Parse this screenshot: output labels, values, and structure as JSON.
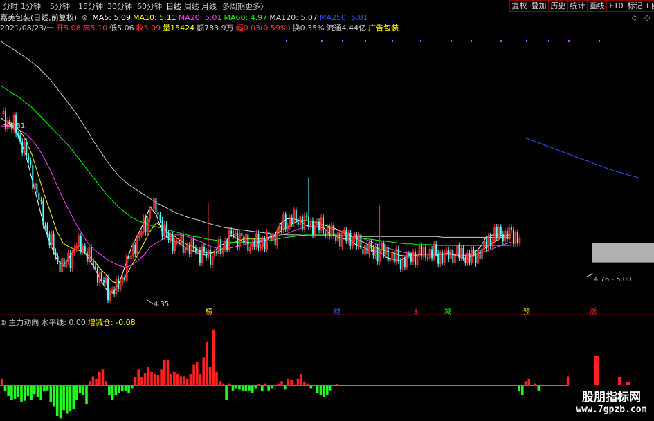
{
  "toolbar": {
    "timeframes": [
      "分时",
      "1分钟",
      "5分钟",
      "15分钟",
      "30分钟",
      "60分钟",
      "日线",
      "周线",
      "月线",
      "多周期",
      "更多〉"
    ],
    "active_timeframe": "日线",
    "right_buttons": [
      "复权",
      "叠加",
      "历史",
      "统计",
      "画线",
      "F10",
      "标记",
      "+自"
    ]
  },
  "header": {
    "stock_name": "嘉美包装(日线,前复权)",
    "ma": [
      {
        "label": "MA5: 5.09",
        "color": "#ffffff"
      },
      {
        "label": "MA10: 5.11",
        "color": "#ffff00"
      },
      {
        "label": "MA20: 5.01",
        "color": "#ff40ff"
      },
      {
        "label": "MA60: 4.97",
        "color": "#00ff00"
      },
      {
        "label": "MA120: 5.07",
        "color": "#d0d0d0"
      },
      {
        "label": "MA250: 5.81",
        "color": "#3050ff"
      }
    ]
  },
  "quote": {
    "date": "2021/08/23/一",
    "open_label": "开",
    "open": "5.08",
    "high_label": "高",
    "high": "5.10",
    "low_label": "低",
    "low": "5.06",
    "close_label": "收",
    "close": "5.09",
    "vol_label": "量",
    "vol": "15424",
    "amount_label": "额",
    "amount": "783.9万",
    "chg_label": "幅",
    "chg": "0.03(0.59%)",
    "turnover_label": "换",
    "turnover": "0.35%",
    "float_label": "流通",
    "float": "4.44亿",
    "sector": "广告包装"
  },
  "indicator": {
    "name": "主力动向",
    "level_label": "水平线: 0.00",
    "delta_label": "增减仓: -0.08"
  },
  "annotations": {
    "high_price": "6.81",
    "low_price": "4.35",
    "range": "4.76 - 5.00"
  },
  "event_markers": [
    {
      "text": "榜",
      "color": "#ffd700"
    },
    {
      "text": "财",
      "color": "#3060ff"
    },
    {
      "text": "$",
      "color": "#ff3030"
    },
    {
      "text": "减",
      "color": "#00ff00"
    },
    {
      "text": "预",
      "color": "#ffd700"
    },
    {
      "text": "涨",
      "color": "#ff3030"
    }
  ],
  "watermark": {
    "line1": "股朋指标网",
    "line2": "www.7gpzb.com"
  },
  "colors": {
    "up": "#ff3232",
    "down": "#54ffff",
    "hist_up": "#ff2020",
    "hist_down": "#20ff20"
  },
  "chart_data": [
    {
      "type": "line",
      "title": "",
      "xlabel": "",
      "ylabel": "",
      "ylim": [
        4.2,
        7.6
      ],
      "x": [
        0,
        3,
        6,
        9,
        12,
        15,
        18,
        21,
        24,
        27,
        30,
        33,
        36,
        39,
        42,
        45,
        48,
        51,
        54,
        57,
        60,
        63,
        66,
        69,
        72,
        75,
        78,
        81,
        84,
        87,
        90,
        93,
        96,
        99,
        102,
        105,
        108,
        111,
        114,
        117,
        120,
        123,
        126,
        129,
        132,
        135,
        138,
        141,
        144,
        147,
        150,
        153,
        156,
        159,
        162,
        165,
        168,
        171,
        174,
        177,
        180,
        183,
        186,
        189,
        192,
        195,
        198,
        201,
        204,
        207,
        210,
        213,
        216,
        219,
        222,
        225,
        228,
        231,
        234,
        237,
        240,
        243,
        246,
        249,
        252,
        255,
        258,
        261,
        264,
        267,
        270,
        273,
        276,
        279,
        282,
        285,
        288,
        291,
        294,
        297,
        300,
        303,
        306
      ],
      "series": [
        {
          "name": "MA5",
          "values": [
            6.55,
            6.5,
            6.45,
            6.3,
            6.1,
            5.8,
            5.5,
            5.2,
            4.98,
            4.8,
            4.72,
            4.82,
            4.95,
            4.95,
            4.82,
            4.7,
            4.55,
            4.42,
            4.38,
            4.5,
            4.72,
            4.95,
            5.1,
            5.25,
            5.45,
            5.35,
            5.12,
            5.05,
            5.02,
            4.98,
            4.92,
            4.9,
            4.86,
            4.85,
            4.88,
            4.95,
            5.0,
            5.1,
            5.05,
            5.02,
            5.0,
            5.0,
            5.02,
            5.05,
            5.1,
            5.25,
            5.3,
            5.3,
            5.28,
            5.22,
            5.2,
            5.2,
            5.18,
            5.1,
            5.08,
            5.05,
            5.05,
            4.98,
            4.95,
            4.92,
            4.9,
            4.88,
            4.82,
            4.8,
            4.78,
            4.82,
            4.86,
            4.86,
            4.86,
            4.86,
            4.85,
            4.86,
            4.88,
            4.85,
            4.82,
            4.8,
            4.88,
            4.95,
            5.08,
            5.1,
            5.1,
            5.09,
            5.09
          ]
        },
        {
          "name": "MA10",
          "values": [
            6.5,
            6.5,
            6.48,
            6.4,
            6.28,
            6.1,
            5.85,
            5.6,
            5.38,
            5.15,
            5.0,
            4.95,
            4.92,
            4.9,
            4.85,
            4.78,
            4.68,
            4.6,
            4.52,
            4.5,
            4.58,
            4.72,
            4.85,
            5.0,
            5.15,
            5.25,
            5.2,
            5.12,
            5.08,
            5.02,
            4.98,
            4.95,
            4.9,
            4.88,
            4.88,
            4.9,
            4.95,
            5.0,
            5.02,
            5.05,
            5.05,
            5.05,
            5.05,
            5.07,
            5.1,
            5.15,
            5.2,
            5.25,
            5.28,
            5.28,
            5.27,
            5.25,
            5.22,
            5.2,
            5.17,
            5.13,
            5.1,
            5.06,
            5.02,
            4.98,
            4.95,
            4.92,
            4.9,
            4.88,
            4.85,
            4.84,
            4.84,
            4.85,
            4.86,
            4.86,
            4.86,
            4.86,
            4.86,
            4.85,
            4.84,
            4.84,
            4.85,
            4.88,
            4.95,
            5.0,
            5.05,
            5.09,
            5.11
          ]
        },
        {
          "name": "MA20",
          "values": [
            6.45,
            6.45,
            6.43,
            6.4,
            6.35,
            6.28,
            6.18,
            6.05,
            5.9,
            5.72,
            5.55,
            5.4,
            5.25,
            5.12,
            5.0,
            4.92,
            4.86,
            4.8,
            4.76,
            4.72,
            4.7,
            4.72,
            4.78,
            4.85,
            4.95,
            5.0,
            5.05,
            5.08,
            5.1,
            5.1,
            5.08,
            5.05,
            5.02,
            4.98,
            4.95,
            4.93,
            4.92,
            4.94,
            4.96,
            4.98,
            5.0,
            5.02,
            5.04,
            5.06,
            5.08,
            5.1,
            5.12,
            5.15,
            5.18,
            5.2,
            5.2,
            5.2,
            5.2,
            5.18,
            5.16,
            5.14,
            5.12,
            5.1,
            5.06,
            5.03,
            5.0,
            4.97,
            4.94,
            4.92,
            4.9,
            4.88,
            4.87,
            4.86,
            4.86,
            4.86,
            4.86,
            4.86,
            4.86,
            4.86,
            4.85,
            4.85,
            4.86,
            4.88,
            4.9,
            4.93,
            4.96,
            4.99,
            5.01
          ]
        },
        {
          "name": "MA60",
          "values": [
            6.95,
            6.9,
            6.85,
            6.8,
            6.74,
            6.68,
            6.6,
            6.52,
            6.44,
            6.36,
            6.28,
            6.2,
            6.1,
            6.0,
            5.9,
            5.8,
            5.7,
            5.6,
            5.52,
            5.44,
            5.38,
            5.32,
            5.28,
            5.25,
            5.22,
            5.2,
            5.18,
            5.16,
            5.14,
            5.12,
            5.1,
            5.08,
            5.07,
            5.05,
            5.04,
            5.03,
            5.02,
            5.01,
            5.01,
            5.01,
            5.01,
            5.01,
            5.02,
            5.03,
            5.04,
            5.06,
            5.07,
            5.08,
            5.09,
            5.1,
            5.1,
            5.1,
            5.1,
            5.1,
            5.1,
            5.09,
            5.08,
            5.07,
            5.06,
            5.05,
            5.04,
            5.03,
            5.02,
            5.01,
            5.0,
            4.99,
            4.99,
            4.98,
            4.98,
            4.98,
            4.97,
            4.97,
            4.97,
            4.97,
            4.97,
            4.97,
            4.97,
            4.97,
            4.97,
            4.97,
            4.97,
            4.97,
            4.97
          ]
        },
        {
          "name": "MA120",
          "values": [
            7.5,
            7.45,
            7.4,
            7.35,
            7.3,
            7.24,
            7.18,
            7.1,
            7.02,
            6.92,
            6.82,
            6.72,
            6.62,
            6.5,
            6.38,
            6.25,
            6.14,
            6.02,
            5.92,
            5.83,
            5.76,
            5.7,
            5.65,
            5.6,
            5.55,
            5.5,
            5.46,
            5.42,
            5.38,
            5.35,
            5.32,
            5.3,
            5.28,
            5.25,
            5.23,
            5.21,
            5.19,
            5.18,
            5.17,
            5.16,
            5.15,
            5.14,
            5.13,
            5.12,
            5.11,
            5.11,
            5.1,
            5.1,
            5.1,
            5.09,
            5.09,
            5.09,
            5.09,
            5.09,
            5.09,
            5.09,
            5.09,
            5.08,
            5.08,
            5.08,
            5.08,
            5.08,
            5.08,
            5.08,
            5.08,
            5.08,
            5.08,
            5.08,
            5.08,
            5.08,
            5.08,
            5.07,
            5.07,
            5.07,
            5.07,
            5.07,
            5.07,
            5.07,
            5.07,
            5.07,
            5.07,
            5.07,
            5.07
          ]
        },
        {
          "name": "MA250",
          "values": [
            6.3,
            6.26,
            6.22,
            6.18,
            6.14,
            6.1,
            6.06,
            6.02,
            5.98,
            5.94,
            5.9,
            5.87,
            5.84,
            5.81
          ]
        }
      ]
    },
    {
      "type": "bar",
      "title": "",
      "xlabel": "",
      "ylabel": "",
      "ylim": [
        -0.8,
        1.3
      ],
      "series": [
        {
          "name": "增减仓",
          "values": [
            0.15,
            -0.12,
            -0.22,
            -0.3,
            -0.28,
            -0.25,
            -0.35,
            -0.32,
            -0.22,
            -0.3,
            -0.18,
            -0.25,
            -0.3,
            -0.12,
            -0.1,
            -0.35,
            -0.45,
            -0.65,
            -0.7,
            -0.52,
            -0.6,
            -0.55,
            -0.5,
            -0.3,
            -0.15,
            -0.2,
            -0.4,
            0.1,
            0.2,
            0.15,
            0.3,
            0.35,
            0.1,
            -0.2,
            -0.3,
            -0.2,
            -0.15,
            -0.12,
            -0.1,
            -0.15,
            -0.05,
            0.18,
            0.35,
            0.18,
            0.28,
            0.4,
            0.3,
            0.25,
            0.22,
            0.35,
            0.55,
            0.55,
            0.25,
            0.3,
            0.25,
            0.2,
            0.2,
            0.15,
            0.25,
            0.45,
            0.5,
            0.25,
            0.6,
            0.95,
            0.4,
            1.2,
            0.3,
            0.1,
            0.05,
            -0.3,
            0.05,
            -0.1,
            -0.05,
            -0.08,
            -0.1,
            -0.12,
            -0.1,
            -0.15,
            -0.05,
            0.03,
            -0.12,
            0.05,
            -0.1,
            -0.05,
            0.02,
            0.05,
            0.1,
            -0.08,
            0.15,
            0.12,
            0.02,
            0.15,
            0.25,
            0.08,
            0.05,
            -0.05,
            0.02,
            -0.15,
            -0.2,
            -0.25,
            -0.2,
            -0.1,
            0.02,
            0.03,
            0.02,
            0.02,
            0.02,
            0.02,
            0.02,
            0.02,
            0.02,
            0.02,
            0.02,
            0.02,
            0.02,
            0.02,
            0.02,
            0.02,
            0.02,
            0.02,
            0.02,
            0.02,
            0.02,
            0.02,
            0.02,
            0.02,
            0.02,
            0.02,
            0.02,
            0.02,
            0.02,
            0.02,
            0.02,
            0.02,
            0.02,
            0.02,
            0.02,
            0.02,
            0.02,
            0.02,
            0.02,
            0.02,
            0.02,
            0.02,
            0.02,
            0.02,
            0.02,
            0.02,
            0.02,
            0.02,
            0.02,
            0.02,
            0.02,
            0.02,
            0.02,
            0.02,
            0.02,
            0.02,
            0.02,
            -0.12,
            -0.2,
            0.1,
            0.15,
            0.02,
            0.05,
            -0.1,
            0.02,
            0.02,
            0.02,
            0.02,
            0.02,
            0.02,
            0.02,
            0.02,
            0.2,
            0.35,
            0.02,
            0.02,
            0.02,
            0.02,
            0.02,
            0.02,
            0.02,
            0.02,
            0.02,
            0.4,
            0.75,
            0.02,
            0.02,
            0.02,
            0.02,
            0.02,
            0.15,
            0.02,
            0.05,
            0.15
          ]
        }
      ]
    }
  ]
}
